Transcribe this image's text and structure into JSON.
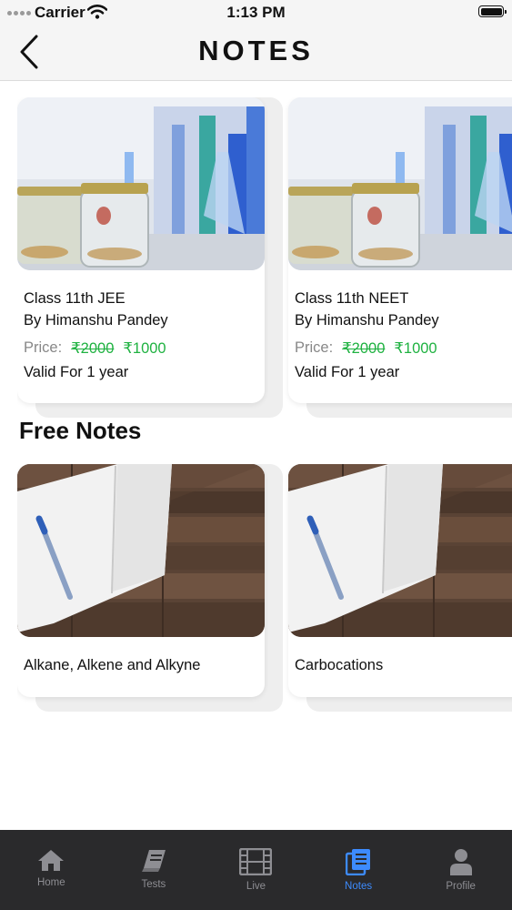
{
  "status_bar": {
    "carrier": "Carrier",
    "time": "1:13 PM"
  },
  "header": {
    "title": "NOTES"
  },
  "paid_notes": [
    {
      "title": "Class 11th JEE",
      "author": "By Himanshu Pandey",
      "price_label": "Price:",
      "old_price": "₹2000",
      "new_price": "₹1000",
      "validity": "Valid For 1 year"
    },
    {
      "title": "Class 11th NEET",
      "author": "By Himanshu Pandey",
      "price_label": "Price:",
      "old_price": "₹2000",
      "new_price": "₹1000",
      "validity": "Valid For 1 year"
    }
  ],
  "free_section": {
    "heading": "Free Notes",
    "items": [
      {
        "title": "Alkane, Alkene and Alkyne"
      },
      {
        "title": "Carbocations"
      }
    ]
  },
  "tab_bar": {
    "active": "notes",
    "tabs": [
      {
        "id": "home",
        "label": "Home",
        "icon": "home-icon"
      },
      {
        "id": "tests",
        "label": "Tests",
        "icon": "book-icon"
      },
      {
        "id": "live",
        "label": "Live",
        "icon": "film-icon"
      },
      {
        "id": "notes",
        "label": "Notes",
        "icon": "notes-icon"
      },
      {
        "id": "profile",
        "label": "Profile",
        "icon": "person-icon"
      }
    ]
  },
  "colors": {
    "price_green": "#1fb241",
    "tab_active": "#3d8bfd",
    "tab_inactive": "#8e8e93",
    "tab_bar_bg": "#2a2a2c"
  }
}
